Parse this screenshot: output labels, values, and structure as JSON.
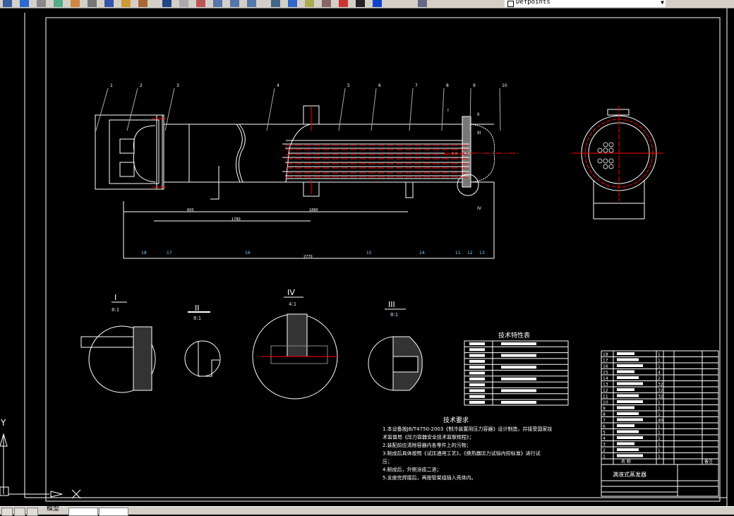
{
  "toolbar": {
    "layer_name": "Defpoints",
    "icons": [
      "open-icon",
      "save-icon",
      "print-icon",
      "preview-icon",
      "publish-icon",
      "cut-icon",
      "copy-icon",
      "paste-icon",
      "match-properties-icon",
      "undo-icon",
      "redo-icon",
      "pan-icon",
      "zoom-realtime-icon",
      "zoom-window-icon",
      "zoom-previous-icon",
      "properties-icon",
      "design-center-icon",
      "tool-palettes-icon",
      "sheet-set-icon",
      "markup-icon",
      "calculator-icon",
      "help-icon",
      "layer-manager-icon"
    ]
  },
  "status_bar": {
    "model_tab": "模型"
  },
  "drawing": {
    "balloons_top": [
      "1",
      "2",
      "3",
      "4",
      "5",
      "6",
      "7",
      "8",
      "9",
      "10"
    ],
    "balloons_bottom": [
      "18",
      "17",
      "16",
      "15",
      "14",
      "11",
      "12",
      "13"
    ],
    "detail_marks": [
      "I",
      "II",
      "III",
      "IV"
    ],
    "dimensions": [
      "600",
      "1780",
      "1880",
      "2770"
    ],
    "details": [
      {
        "label": "I",
        "scale": "8:1"
      },
      {
        "label": "II",
        "scale": "8:1"
      },
      {
        "label": "IV",
        "scale": "4:1"
      },
      {
        "label": "III",
        "scale": "8:1"
      }
    ],
    "colors": {
      "background": "#000000",
      "lines": "#ffffff",
      "centerlines": "#ff0000",
      "hatch": "#9a9a9a"
    }
  },
  "spec_table": {
    "title": "技术特性表"
  },
  "requirements": {
    "title": "技术要求",
    "lines": [
      "1.本设备按JB/T4750-2003《制冷装置用压力容器》设计制造，并接受国家技",
      "术监督局《压力容器安全技术监察规程》；",
      "2.装配前应清除容器内各零件上的污物；",
      "3.制成后具体按照《试压通用工艺》，《换热器压力试验内控标准》进行试",
      "压；",
      "4.制成后，外侧涂底二道；",
      "5.支座完焊接后，再按管架组插入壳体内。"
    ]
  },
  "title_block": {
    "parts": [
      {
        "no": "18",
        "qty": "1"
      },
      {
        "no": "17",
        "qty": "1"
      },
      {
        "no": "16",
        "qty": "1"
      },
      {
        "no": "15",
        "qty": "4"
      },
      {
        "no": "14",
        "qty": "2"
      },
      {
        "no": "13",
        "qty": "32"
      },
      {
        "no": "12",
        "qty": "32"
      },
      {
        "no": "11",
        "qty": "32"
      },
      {
        "no": "10",
        "qty": "1"
      },
      {
        "no": "9",
        "qty": "1"
      },
      {
        "no": "8",
        "qty": "1"
      },
      {
        "no": "7",
        "qty": "40"
      },
      {
        "no": "6",
        "qty": "1"
      },
      {
        "no": "5",
        "qty": "1"
      },
      {
        "no": "4",
        "qty": "1"
      },
      {
        "no": "3",
        "qty": "1"
      },
      {
        "no": "2",
        "qty": "1"
      },
      {
        "no": "1",
        "qty": "1"
      }
    ],
    "header_name": "名 称",
    "header_remark": "备注",
    "drawing_title": "满液式蒸发器"
  }
}
